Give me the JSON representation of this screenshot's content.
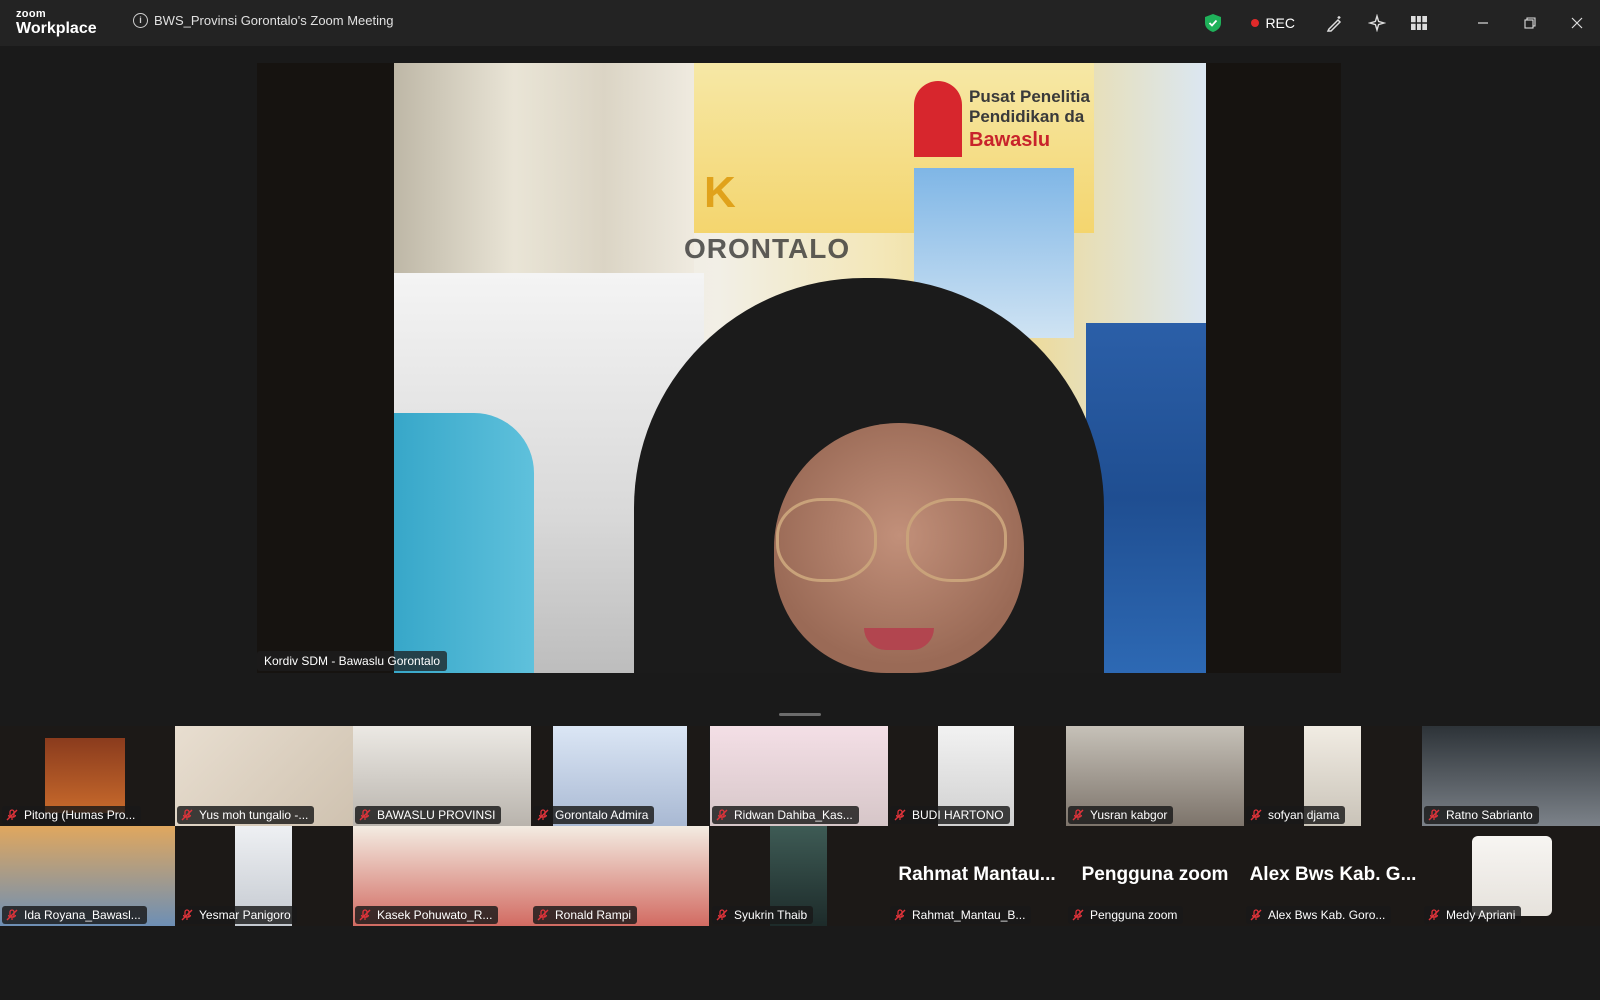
{
  "app": {
    "logo_top": "zoom",
    "logo_bottom": "Workplace"
  },
  "meeting": {
    "title": "BWS_Provinsi Gorontalo's Zoom Meeting",
    "recording_label": "REC"
  },
  "colors": {
    "accent_green": "#1fb15a",
    "rec_red": "#e02a2a",
    "mic_muted_red": "#e0333a"
  },
  "toolbar_icons": [
    "shield-icon",
    "annotate-icon",
    "ai-companion-icon",
    "view-grid-icon"
  ],
  "window_controls": [
    "minimize",
    "restore",
    "close"
  ],
  "main_video": {
    "speaker_name": "Kordiv SDM - Bawaslu Gorontalo",
    "backdrop_text_1": "Pusat Penelitia",
    "backdrop_text_2": "Pendidikan da",
    "backdrop_text_3": "Bawaslu",
    "backdrop_text_4": "ORONTALO"
  },
  "participants": [
    {
      "name": "Pitong (Humas Pro...",
      "muted": true,
      "display": "image"
    },
    {
      "name": "Yus moh tungalio -...",
      "muted": true,
      "display": "image"
    },
    {
      "name": "BAWASLU PROVINSI",
      "muted": true,
      "display": "video"
    },
    {
      "name": "Gorontalo Admira",
      "muted": true,
      "display": "video"
    },
    {
      "name": "Ridwan Dahiba_Kas...",
      "muted": true,
      "display": "video"
    },
    {
      "name": "BUDI HARTONO",
      "muted": true,
      "display": "video"
    },
    {
      "name": "Yusran kabgor",
      "muted": true,
      "display": "video"
    },
    {
      "name": "sofyan djama",
      "muted": true,
      "display": "video"
    },
    {
      "name": "Ratno Sabrianto",
      "muted": true,
      "display": "video"
    },
    {
      "name": "Ida Royana_Bawasl...",
      "muted": true,
      "display": "video"
    },
    {
      "name": "Yesmar Panigoro",
      "muted": true,
      "display": "video"
    },
    {
      "name": "Kasek Pohuwato_R...",
      "muted": true,
      "display": "video"
    },
    {
      "name": "Ronald Rampi",
      "muted": true,
      "display": "video"
    },
    {
      "name": "Syukrin Thaib",
      "muted": true,
      "display": "video"
    },
    {
      "name": "Rahmat_Mantau_B...",
      "muted": true,
      "display": "name",
      "big_name": "Rahmat  Mantau..."
    },
    {
      "name": "Pengguna zoom",
      "muted": true,
      "display": "name",
      "big_name": "Pengguna zoom"
    },
    {
      "name": "Alex Bws Kab. Goro...",
      "muted": true,
      "display": "name",
      "big_name": "Alex  Bws  Kab.  G..."
    },
    {
      "name": "Medy Apriani",
      "muted": true,
      "display": "image"
    }
  ]
}
